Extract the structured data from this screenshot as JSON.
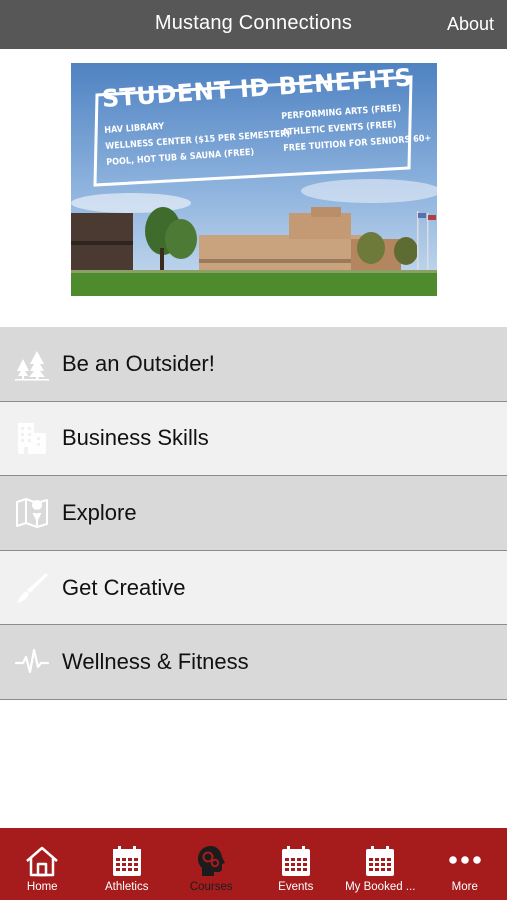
{
  "header": {
    "title": "Mustang Connections",
    "about_label": "About"
  },
  "banner": {
    "title": "STUDENT ID BENEFITS",
    "benefits_left": [
      "HAV LIBRARY",
      "WELLNESS CENTER ($15 PER SEMESTER)",
      "POOL, HOT TUB & SAUNA (FREE)"
    ],
    "benefits_right": [
      "PERFORMING ARTS (FREE)",
      "ATHLETIC EVENTS (FREE)",
      "FREE TUITION FOR SENIORS 60+"
    ]
  },
  "menu": {
    "items": [
      {
        "label": "Be an Outsider!",
        "icon": "trees-icon"
      },
      {
        "label": "Business Skills",
        "icon": "building-icon"
      },
      {
        "label": "Explore",
        "icon": "map-pin-icon"
      },
      {
        "label": "Get Creative",
        "icon": "paintbrush-icon"
      },
      {
        "label": "Wellness & Fitness",
        "icon": "heartbeat-icon"
      }
    ]
  },
  "tabs": [
    {
      "label": "Home",
      "icon": "home-icon"
    },
    {
      "label": "Athletics",
      "icon": "calendar-icon"
    },
    {
      "label": "Courses",
      "icon": "head-gears-icon",
      "active": true
    },
    {
      "label": "Events",
      "icon": "calendar-icon"
    },
    {
      "label": "My Booked ...",
      "icon": "calendar-icon"
    },
    {
      "label": "More",
      "icon": "more-dots-icon"
    }
  ],
  "colors": {
    "header_bg": "#575757",
    "tabbar_bg": "#a61c1c",
    "row_dark": "#d9d9d9",
    "row_light": "#f1f1f1"
  }
}
